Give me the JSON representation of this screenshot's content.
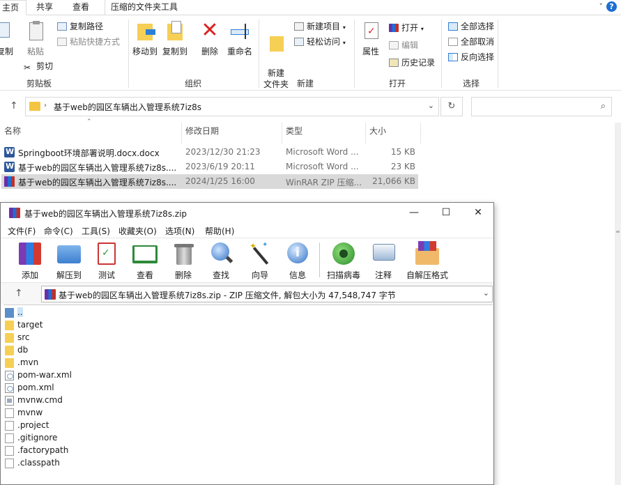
{
  "explorer": {
    "tabs": [
      "主页",
      "共享",
      "查看",
      "压缩的文件夹工具"
    ],
    "ribbon": {
      "groups": {
        "clipboard": "剪贴板",
        "organize": "组织",
        "new": "新建",
        "open": "打开",
        "select": "选择"
      },
      "clipboard": {
        "copy": "复制",
        "paste": "粘贴",
        "copy_path": "复制路径",
        "paste_shortcut": "粘贴快捷方式",
        "cut": "剪切"
      },
      "organize": {
        "move_to": "移动到",
        "copy_to": "复制到",
        "delete": "删除",
        "rename": "重命名"
      },
      "new": {
        "new_folder": "新建\n文件夹",
        "new_item": "新建项目",
        "easy_access": "轻松访问"
      },
      "open": {
        "properties": "属性",
        "open": "打开",
        "edit": "编辑",
        "history": "历史记录"
      },
      "select": {
        "select_all": "全部选择",
        "select_none": "全部取消",
        "invert": "反向选择"
      }
    },
    "address": "基于web的园区车辆出入管理系统7iz8s",
    "columns": {
      "name": "名称",
      "date": "修改日期",
      "type": "类型",
      "size": "大小"
    },
    "files": [
      {
        "name": "Springboot环境部署说明.docx.docx",
        "date": "2023/12/30 21:23",
        "type": "Microsoft Word ...",
        "size": "15 KB",
        "icon": "word-icon",
        "selected": false
      },
      {
        "name": "基于web的园区车辆出入管理系统7iz8s....",
        "date": "2023/6/19 20:11",
        "type": "Microsoft Word ...",
        "size": "23 KB",
        "icon": "word-icon",
        "selected": false
      },
      {
        "name": "基于web的园区车辆出入管理系统7iz8s....",
        "date": "2024/1/25 16:00",
        "type": "WinRAR ZIP 压缩...",
        "size": "21,066 KB",
        "icon": "winrar-icon",
        "selected": true
      }
    ]
  },
  "winrar": {
    "title": "基于web的园区车辆出入管理系统7iz8s.zip",
    "menu": [
      "文件(F)",
      "命令(C)",
      "工具(S)",
      "收藏夹(O)",
      "选项(N)",
      "帮助(H)"
    ],
    "toolbar": [
      "添加",
      "解压到",
      "测试",
      "查看",
      "删除",
      "查找",
      "向导",
      "信息",
      "扫描病毒",
      "注释",
      "自解压格式"
    ],
    "path": "基于web的园区车辆出入管理系统7iz8s.zip - ZIP 压缩文件, 解包大小为 47,548,747 字节",
    "items": [
      {
        "name": "..",
        "kind": "updir"
      },
      {
        "name": "target",
        "kind": "folder"
      },
      {
        "name": "src",
        "kind": "folder"
      },
      {
        "name": "db",
        "kind": "folder"
      },
      {
        "name": ".mvn",
        "kind": "folder"
      },
      {
        "name": "pom-war.xml",
        "kind": "xml"
      },
      {
        "name": "pom.xml",
        "kind": "xml"
      },
      {
        "name": "mvnw.cmd",
        "kind": "cmd"
      },
      {
        "name": "mvnw",
        "kind": "file"
      },
      {
        "name": ".project",
        "kind": "file"
      },
      {
        "name": ".gitignore",
        "kind": "file"
      },
      {
        "name": ".factorypath",
        "kind": "file"
      },
      {
        "name": ".classpath",
        "kind": "file"
      }
    ]
  }
}
